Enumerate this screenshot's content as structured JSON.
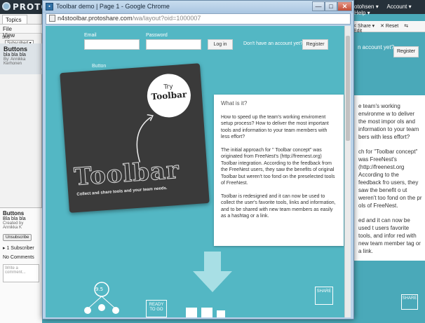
{
  "bg_app": {
    "logo": "PROTOSHARE",
    "topnav": [
      "otohsen ▾",
      "Account ▾",
      "Help ▾"
    ],
    "left_tab": "Topics",
    "menu": [
      "File",
      "View"
    ],
    "filter_label": "Sho",
    "filter_value": "Subscribed ▾",
    "topic": {
      "title": "Buttons",
      "subtitle": "bla bla bla",
      "author": "By: Annikka Kerhonen"
    },
    "detail": {
      "title": "Buttons",
      "subtitle": "Bla bla bla",
      "created": "Created by Annikka K",
      "unsubscribe": "Unsubscribe",
      "subscriber": "▸ 1 Subscriber",
      "no_comments": "No Comments",
      "comment_placeholder": "Write a comment..."
    },
    "right_toolbar": [
      "< Share ▾",
      "✕ Reset",
      "⇆ Edit"
    ],
    "right_account": "n account yet?",
    "right_register": "Register",
    "right_paragraphs": [
      "e team's working environme w to deliver the most impor ols and information to your team bers with less effort?",
      "ch for \"Toolbar concept\" was FreeNest's (http://freenest.org According to the feedback fro users, they saw the benefit o ut weren't too fond on the pr ols of FreeNest.",
      "ed and it can now be used t users favorite tools, and infor red with new team member tag or a link."
    ],
    "right_share": "SHARE"
  },
  "window": {
    "title": "Toolbar demo | Page 1 - Google Chrome",
    "url_main": "n4stoolbar.protoshare.com",
    "url_rest": "/wa/layout?oid=1000007",
    "min": "—",
    "max": "□",
    "close": "✕"
  },
  "page": {
    "email_label": "Email",
    "password_label": "Password",
    "login_button": "Log in",
    "no_account_text": "Don't have an account yet?",
    "register_button": "Register",
    "button_caption": "Button",
    "poster": {
      "try": "Try",
      "toolbar_small": "Toolbar",
      "toolbar_big": "Toolbar",
      "tagline": "Collect and share tools and your team needs."
    },
    "info": {
      "heading": "What is it?",
      "p1": "How to speed up the team's working enviroment setup process? How to deliver the most important tools and information to your team members with less effort?",
      "p2": "The initial approach for \" Toolbar concept\" was originated from FreeNest's (http://freenest.org) Toolbar integration. According to the feedback from the FreeNest users, they saw the benefits of original Toolbar but weren't too fond on the preselected tools of FreeNest.",
      "p3": "Toolbar is redesigned and it can now be used to collect the user's favorite tools, links and information, and to be shared with new team members as easily as a hashtag or a link."
    },
    "footer": {
      "share": "SHARE",
      "ready": "READY TO GO",
      "cluster_badge": "9.5"
    }
  },
  "colors": {
    "page_teal": "#53b7c4",
    "bg_teal": "#4aa9b9",
    "poster_dark": "#3a3a3a",
    "arrow_light": "#a8dfe5"
  }
}
